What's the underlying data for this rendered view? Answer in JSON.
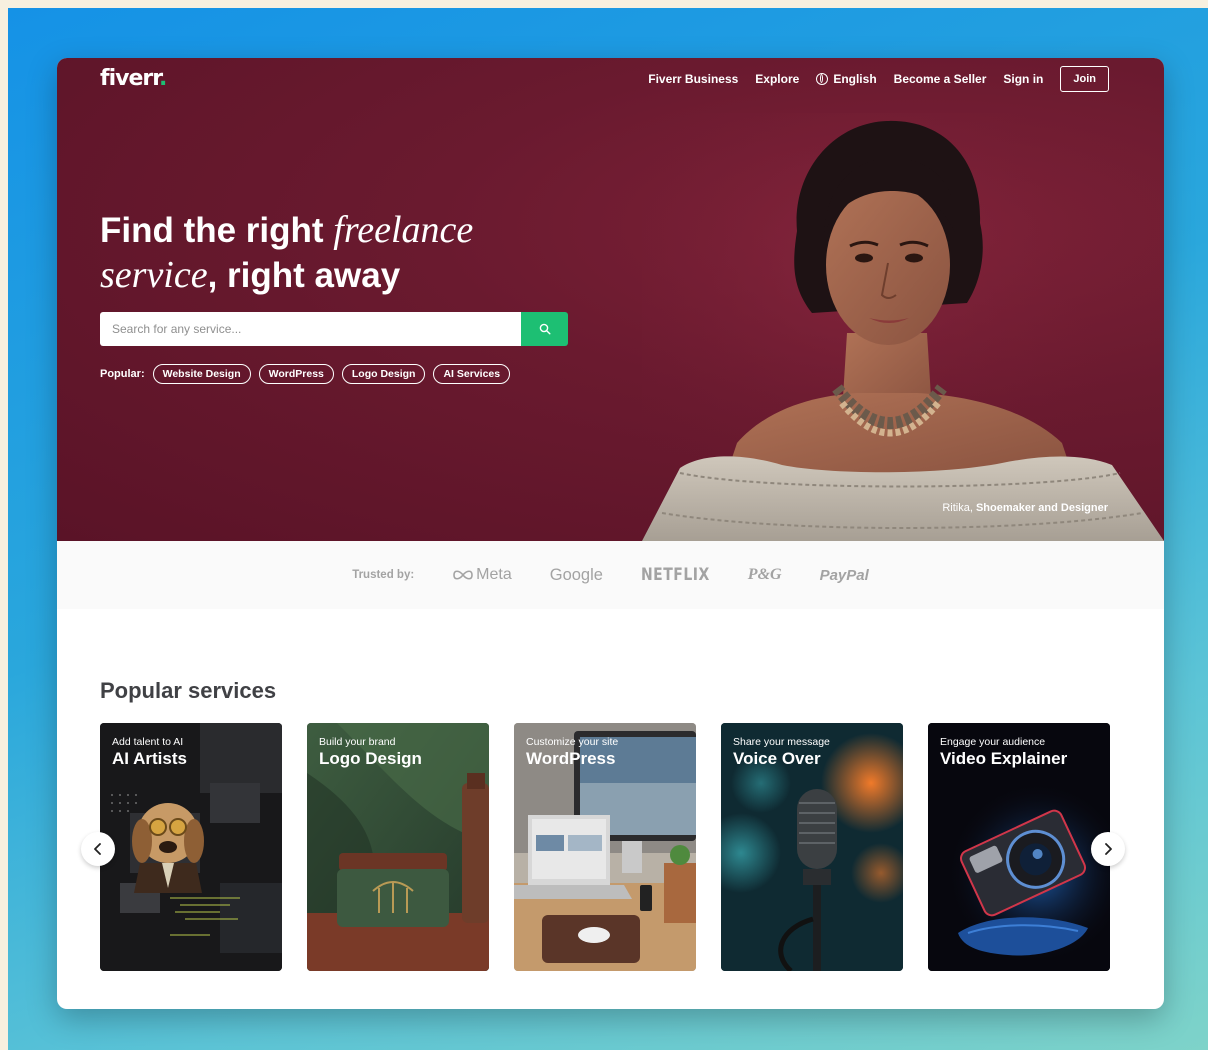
{
  "header": {
    "logo": "fiverr",
    "logo_dot": ".",
    "nav": {
      "business": "Fiverr Business",
      "explore": "Explore",
      "language": "English",
      "become_seller": "Become a Seller",
      "sign_in": "Sign in",
      "join": "Join"
    }
  },
  "hero": {
    "headline_part1": "Find the right ",
    "headline_em1": "freelance",
    "headline_em2": "service",
    "headline_part2": ", right away",
    "search_placeholder": "Search for any service...",
    "popular_label": "Popular:",
    "popular_chips": [
      "Website Design",
      "WordPress",
      "Logo Design",
      "AI Services"
    ],
    "caption_name": "Ritika, ",
    "caption_role": "Shoemaker and Designer"
  },
  "trusted": {
    "label": "Trusted by:",
    "brands": [
      "Meta",
      "Google",
      "NETFLIX",
      "P&G",
      "PayPal"
    ]
  },
  "popular_services": {
    "title": "Popular services",
    "cards": [
      {
        "subtitle": "Add talent to AI",
        "title": "AI Artists"
      },
      {
        "subtitle": "Build your brand",
        "title": "Logo Design"
      },
      {
        "subtitle": "Customize your site",
        "title": "WordPress"
      },
      {
        "subtitle": "Share your message",
        "title": "Voice Over"
      },
      {
        "subtitle": "Engage your audience",
        "title": "Video Explainer"
      }
    ]
  },
  "colors": {
    "hero_bg": "#6a1a2f",
    "accent_green": "#1dbf73",
    "page_backdrop": "#2aa7dc"
  }
}
